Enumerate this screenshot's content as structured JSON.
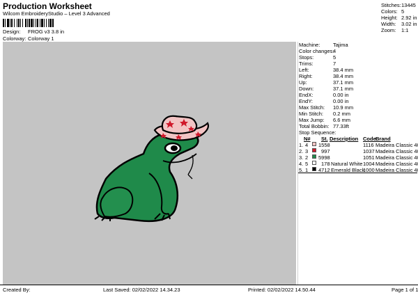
{
  "header": {
    "title": "Production Worksheet",
    "subtitle": "Wilcom EmbroideryStudio – Level 3 Advanced",
    "design_label": "Design:",
    "design_value": "FROG v3 3.8 in",
    "colorway_label": "Colorway:",
    "colorway_value": "Colorway 1"
  },
  "summary": [
    {
      "label": "Stitches:",
      "value": "13445"
    },
    {
      "label": "Colors:",
      "value": "5"
    },
    {
      "label": "Height:",
      "value": "2.92 in"
    },
    {
      "label": "Width:",
      "value": "3.02 in"
    },
    {
      "label": "Zoom:",
      "value": "1:1"
    }
  ],
  "info": [
    {
      "label": "Machine:",
      "value": "Tajima"
    },
    {
      "label": "Color changes:",
      "value": "4"
    },
    {
      "label": "Stops:",
      "value": "5"
    },
    {
      "label": "Trims:",
      "value": "7"
    },
    {
      "label": "Left:",
      "value": "38.4 mm"
    },
    {
      "label": "Right:",
      "value": "38.4 mm"
    },
    {
      "label": "Up:",
      "value": "37.1 mm"
    },
    {
      "label": "Down:",
      "value": "37.1 mm"
    },
    {
      "label": "EndX:",
      "value": "0.00 in"
    },
    {
      "label": "EndY:",
      "value": "0.00 in"
    },
    {
      "label": "Max Stitch:",
      "value": "10.9 mm"
    },
    {
      "label": "Min Stitch:",
      "value": "0.2 mm"
    },
    {
      "label": "Max Jump:",
      "value": "6.6 mm"
    },
    {
      "label": "Total Bobbin:",
      "value": "77.33ft"
    }
  ],
  "stop_sequence": {
    "title": "Stop Sequence:",
    "headers": {
      "n": "N#",
      "st": "St.",
      "description": "Description",
      "code": "Code",
      "brand": "Brand"
    },
    "rows": [
      {
        "stop": "1.",
        "n": "4",
        "color": "#f2c4c4",
        "st": "1558",
        "description": "",
        "code": "1116",
        "brand": "Madeira Classic 40"
      },
      {
        "stop": "2.",
        "n": "3",
        "color": "#d0192b",
        "st": "997",
        "description": "",
        "code": "1037",
        "brand": "Madeira Classic 40"
      },
      {
        "stop": "3.",
        "n": "2",
        "color": "#1f8a4a",
        "st": "5998",
        "description": "",
        "code": "1051",
        "brand": "Madeira Classic 40"
      },
      {
        "stop": "4.",
        "n": "5",
        "color": "#ffffff",
        "st": "178",
        "description": "Natural White",
        "code": "1004",
        "brand": "Madeira Classic 40"
      },
      {
        "stop": "5.",
        "n": "1",
        "color": "#000000",
        "st": "4712",
        "description": "Emerald Black",
        "code": "1000",
        "brand": "Madeira Classic 40"
      }
    ]
  },
  "footer": {
    "created_by": "Created By:",
    "last_saved": "Last Saved: 02/02/2022 14.34.23",
    "printed": "Printed: 02/02/2022 14.50.44",
    "page": "Page 1 of 1"
  },
  "colors": {
    "canvas": "#c4c4c4",
    "frog_green": "#1f8a4a",
    "hat_pink": "#f2c4c4",
    "hat_red": "#d0192b"
  }
}
